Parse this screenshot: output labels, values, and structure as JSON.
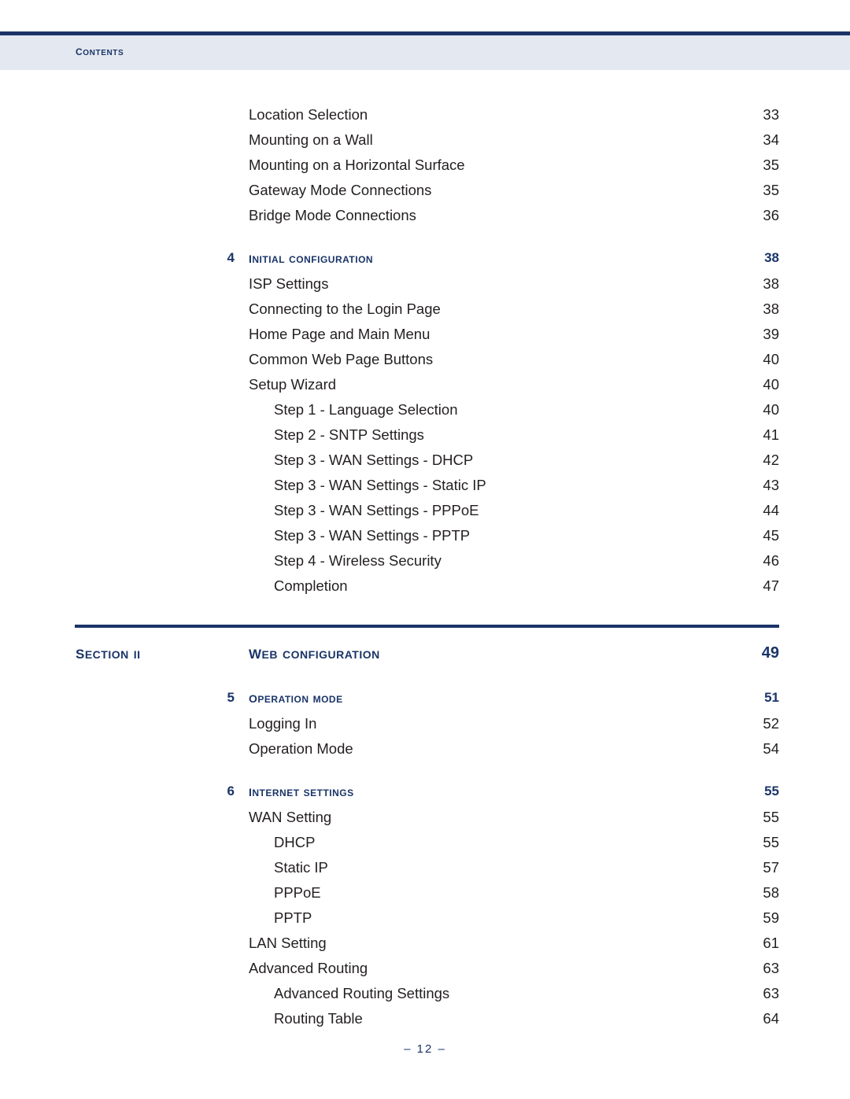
{
  "header": {
    "label": "Contents"
  },
  "toc": {
    "groups": [
      {
        "kind": "entries",
        "items": [
          {
            "level": 0,
            "title": "Location Selection",
            "page": "33"
          },
          {
            "level": 0,
            "title": "Mounting on a Wall",
            "page": "34"
          },
          {
            "level": 0,
            "title": "Mounting on a Horizontal Surface",
            "page": "35"
          },
          {
            "level": 0,
            "title": "Gateway Mode Connections",
            "page": "35"
          },
          {
            "level": 0,
            "title": "Bridge Mode Connections",
            "page": "36"
          }
        ]
      },
      {
        "kind": "chapter",
        "number": "4",
        "title": "Initial Configuration",
        "page": "38",
        "items": [
          {
            "level": 0,
            "title": "ISP Settings",
            "page": "38"
          },
          {
            "level": 0,
            "title": "Connecting to the Login Page",
            "page": "38"
          },
          {
            "level": 0,
            "title": "Home Page and Main Menu",
            "page": "39"
          },
          {
            "level": 0,
            "title": "Common Web Page Buttons",
            "page": "40"
          },
          {
            "level": 0,
            "title": "Setup Wizard",
            "page": "40"
          },
          {
            "level": 1,
            "title": "Step 1 - Language Selection",
            "page": "40"
          },
          {
            "level": 1,
            "title": "Step 2 - SNTP Settings",
            "page": "41"
          },
          {
            "level": 1,
            "title": "Step 3 - WAN Settings - DHCP",
            "page": "42"
          },
          {
            "level": 1,
            "title": "Step 3 - WAN Settings - Static IP",
            "page": "43"
          },
          {
            "level": 1,
            "title": "Step 3 - WAN Settings - PPPoE",
            "page": "44"
          },
          {
            "level": 1,
            "title": "Step 3 - WAN Settings - PPTP",
            "page": "45"
          },
          {
            "level": 1,
            "title": "Step 4 - Wireless Security",
            "page": "46"
          },
          {
            "level": 1,
            "title": "Completion",
            "page": "47"
          }
        ]
      }
    ],
    "section": {
      "label": "Section II",
      "title": "Web Configuration",
      "page": "49"
    },
    "groups_after": [
      {
        "kind": "chapter",
        "number": "5",
        "title": "Operation Mode",
        "page": "51",
        "items": [
          {
            "level": 0,
            "title": "Logging In",
            "page": "52"
          },
          {
            "level": 0,
            "title": "Operation Mode",
            "page": "54"
          }
        ]
      },
      {
        "kind": "chapter",
        "number": "6",
        "title": "Internet Settings",
        "page": "55",
        "items": [
          {
            "level": 0,
            "title": "WAN Setting",
            "page": "55"
          },
          {
            "level": 1,
            "title": "DHCP",
            "page": "55"
          },
          {
            "level": 1,
            "title": "Static IP",
            "page": "57"
          },
          {
            "level": 1,
            "title": "PPPoE",
            "page": "58"
          },
          {
            "level": 1,
            "title": "PPTP",
            "page": "59"
          },
          {
            "level": 0,
            "title": "LAN Setting",
            "page": "61"
          },
          {
            "level": 0,
            "title": "Advanced Routing",
            "page": "63"
          },
          {
            "level": 1,
            "title": "Advanced Routing Settings",
            "page": "63"
          },
          {
            "level": 1,
            "title": "Routing Table",
            "page": "64"
          }
        ]
      }
    ]
  },
  "footer": {
    "text": "–  12  –"
  },
  "colors": {
    "navy": "#1a3468",
    "band": "#e4e8f0",
    "body_text": "#231f20"
  }
}
